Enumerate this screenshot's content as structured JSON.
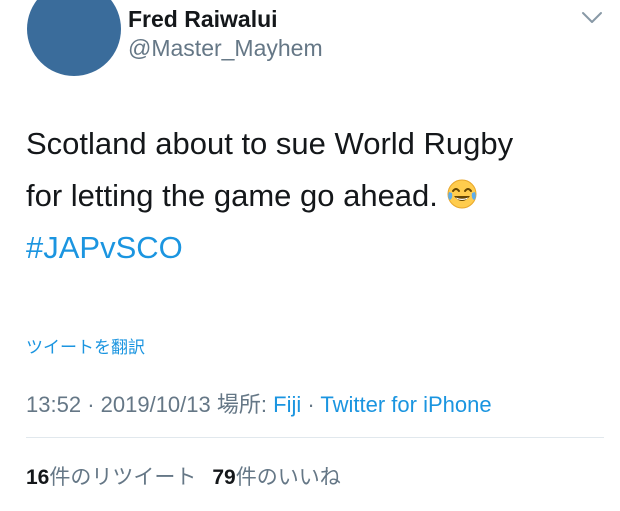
{
  "user": {
    "display_name": "Fred Raiwalui",
    "handle": "@Master_Mayhem",
    "avatar_color": "#3a6c9b"
  },
  "tweet": {
    "line1": "Scotland about to sue World Rugby",
    "line2": "for letting the game go ahead.",
    "emoji": "face-with-tears-of-joy-icon",
    "hashtag": "#JAPvSCO"
  },
  "translate_label": "ツイートを翻訳",
  "meta": {
    "time": "13:52",
    "separator": "·",
    "date": "2019/10/13",
    "place_label": "場所:",
    "place": "Fiji",
    "source": "Twitter for iPhone"
  },
  "stats": {
    "retweets_count": "16",
    "retweets_label": "件のリツイート",
    "likes_count": "79",
    "likes_label": "件のいいね"
  },
  "colors": {
    "link": "#1b95e0",
    "secondary_text": "#657786",
    "primary_text": "#14171a",
    "divider": "#e1e8ed"
  }
}
